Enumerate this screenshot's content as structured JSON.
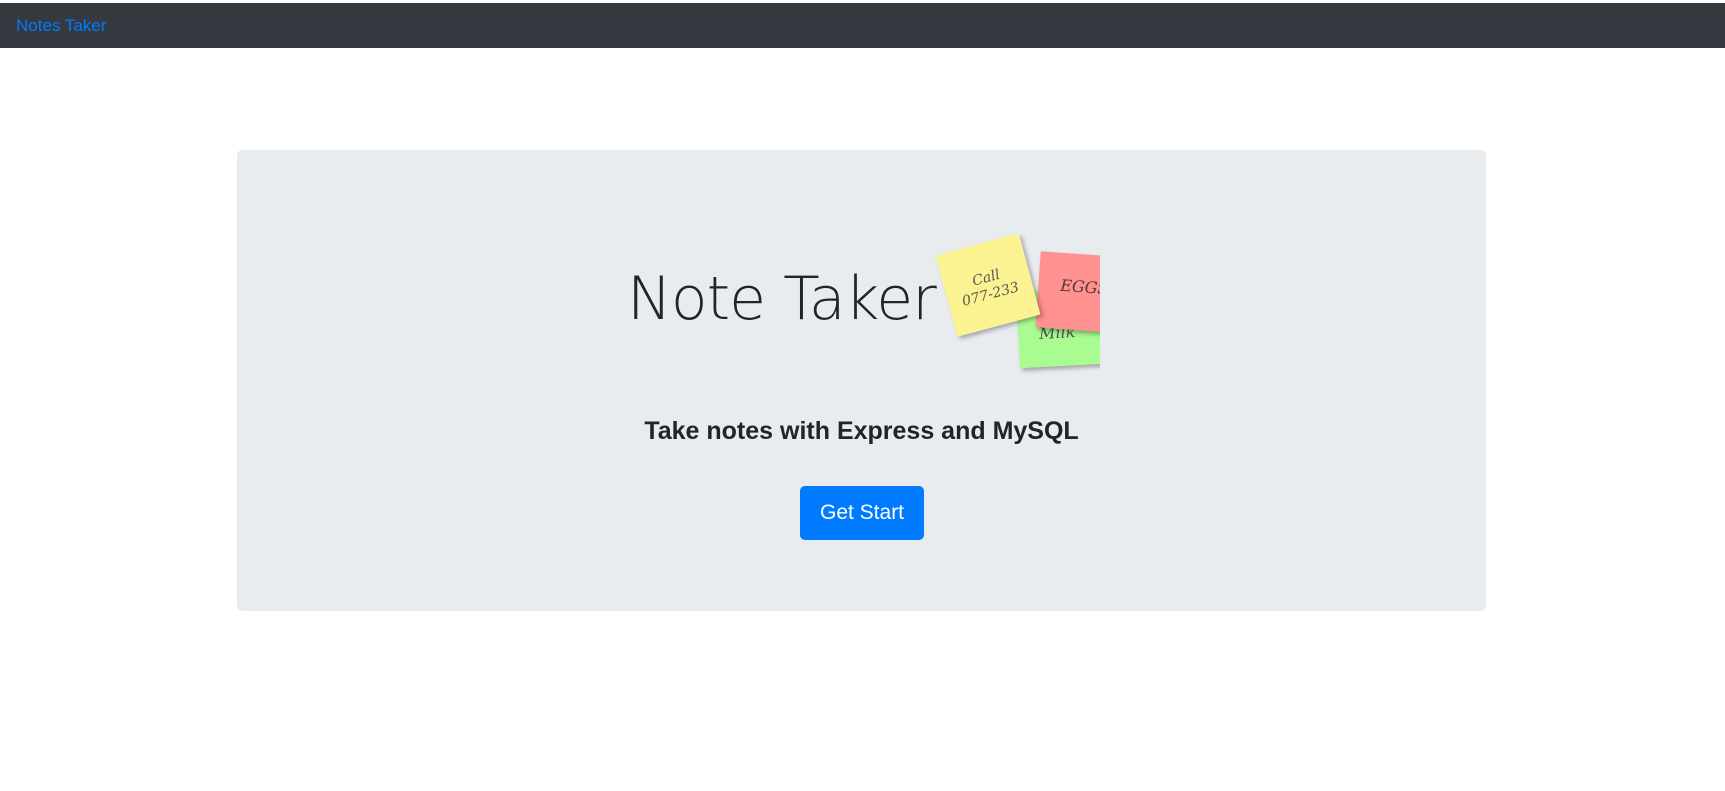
{
  "navbar": {
    "brand_label": "Notes Taker"
  },
  "hero": {
    "title": "Note Taker",
    "subtitle": "Take notes with Express and MySQL",
    "cta_label": "Get Start",
    "sticky_notes": {
      "yellow_line1": "Call",
      "yellow_line2": "077-233",
      "red": "EGGS",
      "green": "Milk"
    }
  },
  "colors": {
    "navbar_bg": "#343a40",
    "brand": "#007bff",
    "jumbotron_bg": "#e9ecef",
    "button_bg": "#007bff",
    "note_yellow": "#fbf291",
    "note_red": "#ff9190",
    "note_green": "#a9fc8f"
  }
}
